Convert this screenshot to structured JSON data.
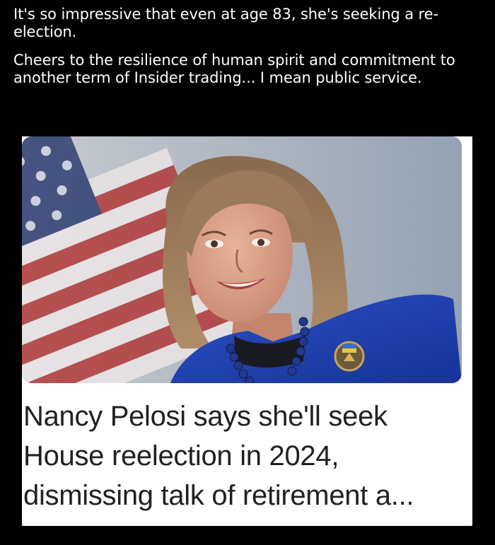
{
  "post": {
    "caption_line1": "It's so impressive that even at age 83, she's seeking a re-election.",
    "caption_line2": "Cheers to the resilience of human spirit and commitment to another term of Insider trading... I mean public service."
  },
  "article": {
    "headline": "Nancy Pelosi says she'll seek House reelection in 2024, dismissing talk of retirement a..."
  },
  "colors": {
    "background": "#000000",
    "caption_text": "#ffffff",
    "card_background": "#ffffff",
    "headline_text": "#202124",
    "jacket_blue": "#1f3fa8",
    "flag_red": "#b23a3a"
  }
}
